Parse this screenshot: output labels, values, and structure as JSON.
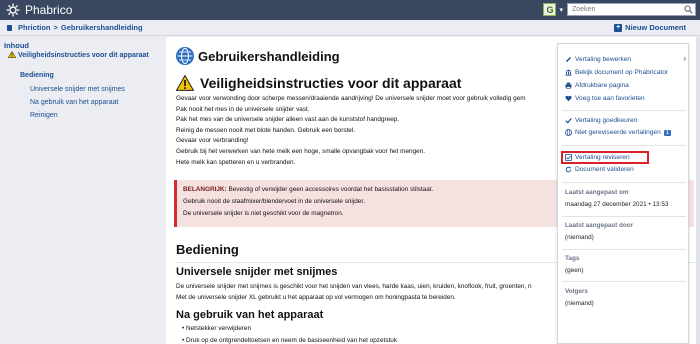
{
  "app": {
    "title": "Phabrico"
  },
  "topbar": {
    "search_placeholder": "Zoeken",
    "g_label": "G",
    "g_caret": "▾"
  },
  "breadcrumb": {
    "root": "Phriction",
    "separator": ">",
    "current": "Gebruikershandleiding"
  },
  "header": {
    "new_doc": "Nieuw Document"
  },
  "sidebar": {
    "heading": "Inhoud",
    "items": [
      "Veiligheidsinstructies voor dit apparaat",
      "Bediening",
      "Universele snijder met snijmes",
      "Na gebruik van het apparaat",
      "Reinigen"
    ]
  },
  "doc": {
    "title": "Gebruikershandleiding",
    "h1": "Veiligheidsinstructies voor dit apparaat",
    "lines": [
      "Gevaar voor verwonding door scherpe messen/draaiende aandrijving! De universele snijder moet voor gebruik volledig gem",
      "Pak nooit het mes in de universele snijder vast.",
      "Pak het mes van de universele snijder alleen vast aan de kunststof handgreep.",
      "Reinig de messen nooit met blote handen. Gebruik een borstel.",
      "Gevaar voor verbranding!",
      "Gebruik bij het verwerken van hete melk een hoge, smalle opvangbak voor het mengen.",
      "Hete melk kan spetteren en u verbranden."
    ],
    "alert": {
      "label": "BELANGRIJK:",
      "line1_rest": " Bevestig of verwijder geen accessoires voordat het basisstation stilstaat.",
      "line2": "Gebruik nooit de staafmixer/blendervoet in de universele snijder.",
      "line3": "De universele snijder is niet geschikt voor de magnetron."
    },
    "bediening": "Bediening",
    "snijder_heading": "Universele snijder met snijmes",
    "snijder_p1": "De universele snijder met snijmes is geschikt voor het snijden van vlees, harde kaas, uien, kruiden, knoflook, fruit, groenten, n",
    "snijder_p2": "Met de universele snijder XL gebruikt u het apparaat op vol vermogen om honingpasta te bereiden.",
    "nagebruik_heading": "Na gebruik van het apparaat",
    "bullets": [
      "Netstekker verwijderen",
      "Druk op de ontgrendeltoetsen en neem de basiseenheid van het opzetstuk"
    ]
  },
  "panel": {
    "actions": [
      "Vertaling bewerken",
      "Bekijk document op Phabricator",
      "Afdrukbare pagina",
      "Voeg toe aan favorieten",
      "Vertaling goedkeuren",
      "Niet gereviseerde vertalingen",
      "Vertaling reviseren",
      "Document valideren"
    ],
    "unreviewed_count": "1",
    "last_modified_label": "Laatst aangepast om",
    "last_modified_value": "maandag 27 december 2021 • 13:53",
    "modified_by_label": "Laatst aangepast door",
    "modified_by_value": "(niemand)",
    "tags_label": "Tags",
    "tags_value": "(geen)",
    "followers_label": "Volgers",
    "followers_value": "(niemand)"
  },
  "colors": {
    "topbar": "#3a4760",
    "link": "#1b4e93",
    "highlight": "#d8232a",
    "alert_bg": "#f6e1e1"
  }
}
